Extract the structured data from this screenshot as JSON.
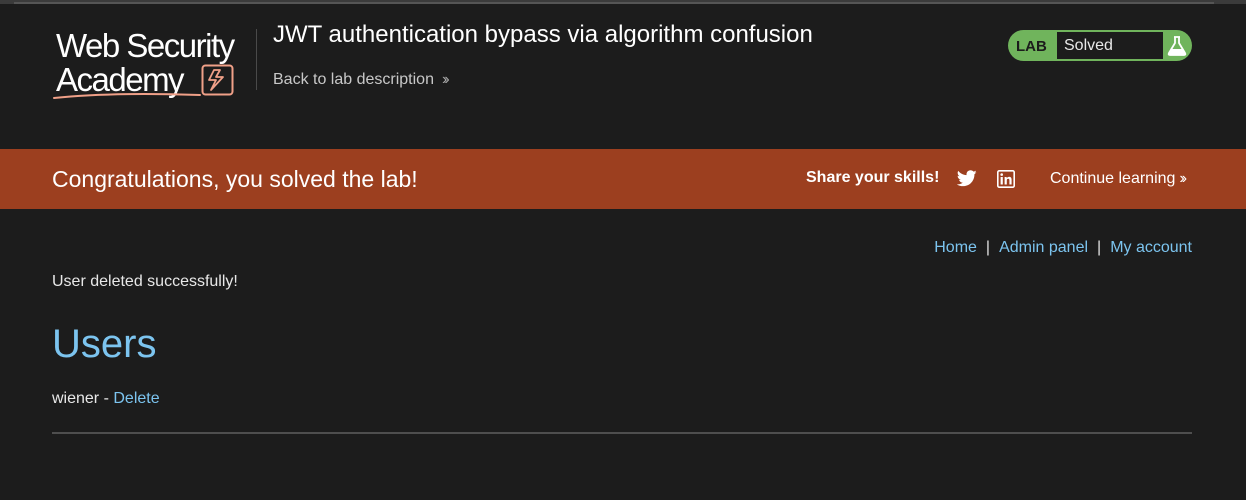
{
  "header": {
    "logo": {
      "line1": "Web Security",
      "line2": "Academy"
    },
    "lab_title": "JWT authentication bypass via algorithm confusion",
    "back_link": "Back to lab description",
    "status": {
      "label": "LAB",
      "value": "Solved",
      "icon": "flask-icon"
    }
  },
  "banner": {
    "message": "Congratulations, you solved the lab!",
    "share_label": "Share your skills!",
    "share_icons": [
      "twitter-icon",
      "linkedin-icon"
    ],
    "continue_label": "Continue learning"
  },
  "nav": {
    "home": "Home",
    "admin_panel": "Admin panel",
    "my_account": "My account",
    "separator": "|"
  },
  "main": {
    "message": "User deleted successfully!",
    "heading": "Users",
    "users": [
      {
        "name": "wiener",
        "separator": "-",
        "action": "Delete"
      }
    ]
  },
  "colors": {
    "background": "#1c1c1c",
    "banner": "#9c3f1f",
    "link": "#7cc4ef",
    "lab_badge": "#70b45c"
  }
}
